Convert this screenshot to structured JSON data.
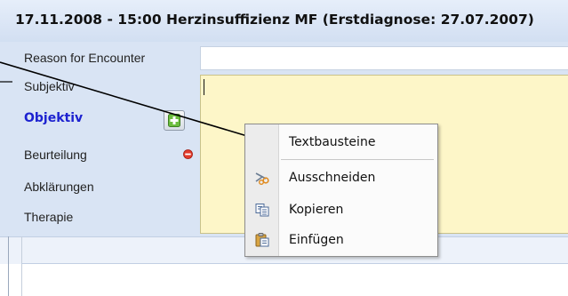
{
  "header": {
    "title": "17.11.2008 - 15:00 Herzinsuffizienz MF (Erstdiagnose: 27.07.2007)"
  },
  "form": {
    "fields": [
      {
        "label": "Reason for Encounter"
      },
      {
        "label": "Subjektiv"
      },
      {
        "label": "Objektiv"
      },
      {
        "label": "Beurteilung"
      },
      {
        "label": "Abklärungen"
      },
      {
        "label": "Therapie"
      }
    ],
    "reason_value": "",
    "subjektiv_value": ""
  },
  "icons": {
    "add": "add-green-plus-icon",
    "remove": "remove-red-minus-icon"
  },
  "context_menu": {
    "items": [
      {
        "label": "Textbausteine",
        "icon": "none"
      },
      {
        "label": "Ausschneiden",
        "icon": "scissors-icon"
      },
      {
        "label": "Kopieren",
        "icon": "copy-icon"
      },
      {
        "label": "Einfügen",
        "icon": "paste-icon"
      }
    ]
  },
  "colors": {
    "accent_label": "#1d22d0",
    "form_background": "#d9e4f4",
    "text_area_background": "#fdf6c8"
  }
}
